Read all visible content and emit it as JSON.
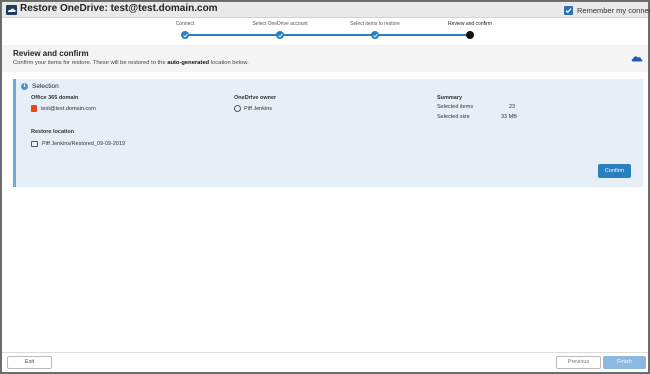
{
  "window": {
    "title": "Restore OneDrive: test@test.domain.com",
    "remember_label": "Remember my connection",
    "remember_checked": true
  },
  "stepper": {
    "steps": [
      {
        "label": "Connect",
        "state": "done"
      },
      {
        "label": "Select OneDrive account",
        "state": "done"
      },
      {
        "label": "Select items to restore",
        "state": "done"
      },
      {
        "label": "Review and confirm",
        "state": "current"
      }
    ]
  },
  "header": {
    "title": "Review and confirm",
    "subtitle_prefix": "Confirm your items for restore. These will be restored to the ",
    "subtitle_bold": "auto-generated",
    "subtitle_suffix": " location below."
  },
  "selection": {
    "title": "Selection",
    "domain_label": "Office 365 domain",
    "domain_value": "test@test.domain.com",
    "owner_label": "OneDrive owner",
    "owner_value": "Piff Jenkins",
    "summary_label": "Summary",
    "selected_items_label": "Selected items",
    "selected_items_value": "23",
    "selected_size_label": "Selected size",
    "selected_size_value": "33 MB",
    "restore_location_label": "Restore location",
    "restore_location_value": "Piff Jenkins/Restored_09-09-2019",
    "confirm_label": "Confirm"
  },
  "footer": {
    "exit_label": "Exit",
    "previous_label": "Previous",
    "finish_label": "Finish"
  },
  "colors": {
    "accent": "#2a7fc0",
    "panel_bg": "#e6eef7",
    "finish_disabled": "#8db8e0",
    "office_icon": "#e64a19"
  }
}
